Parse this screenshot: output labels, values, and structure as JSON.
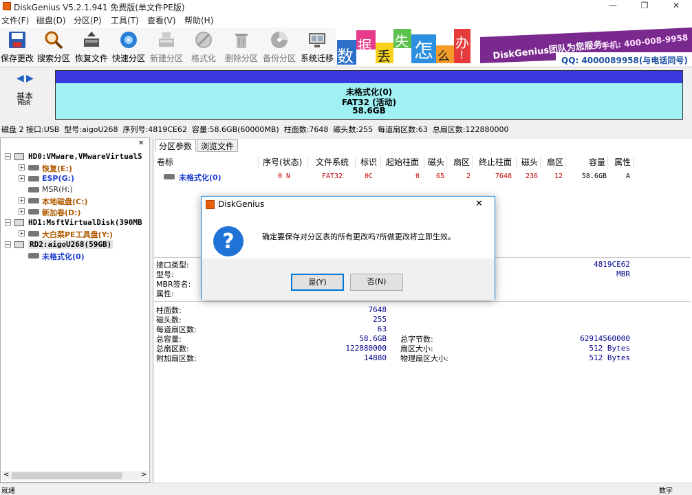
{
  "window": {
    "title": "DiskGenius V5.2.1.941 免费版(单文件PE版)",
    "minimize": "—",
    "maximize": "❐",
    "close": "✕"
  },
  "menu": [
    "文件(F)",
    "磁盘(D)",
    "分区(P)",
    "工具(T)",
    "查看(V)",
    "帮助(H)"
  ],
  "toolbar": [
    "保存更改",
    "搜索分区",
    "恢复文件",
    "快速分区",
    "新建分区",
    "格式化",
    "删除分区",
    "备份分区",
    "系统迁移"
  ],
  "banner": {
    "chars": [
      "数",
      "据",
      "丢",
      "失",
      "怎",
      "么",
      "办",
      "!"
    ],
    "team": "DiskGenius团队为您服务:",
    "phone": "手机: 400-008-9958",
    "qq": "QQ: 4000089958(与电话同号)"
  },
  "diskmap": {
    "type": "基本",
    "scheme": "MBR",
    "part_name": "未格式化(0)",
    "part_fs": "FAT32 (活动)",
    "part_size": "58.6GB"
  },
  "diskinfo": "磁盘 2 接口:USB  型号:aigoU268  序列号:4819CE62  容量:58.6GB(60000MB)  柱面数:7648  磁头数:255  每道扇区数:63  总扇区数:122880000",
  "tree": {
    "hd0": "HD0:VMware,VMwareVirtualS",
    "hd0_parts": [
      "恢复(E:)",
      "ESP(G:)",
      "MSR(H:)",
      "本地磁盘(C:)",
      "新加卷(D:)"
    ],
    "hd1": "HD1:MsftVirtualDisk(390MB",
    "hd1_parts": [
      "大白菜PE工具盘(Y:)"
    ],
    "rd2": "RD2:aigoU268(59GB)",
    "rd2_parts": [
      "未格式化(0)"
    ]
  },
  "tabs": [
    "分区参数",
    "浏览文件"
  ],
  "columns": [
    "卷标",
    "序号(状态)",
    "文件系统",
    "标识",
    "起始柱面",
    "磁头",
    "扇区",
    "终止柱面",
    "磁头",
    "扇区",
    "容量",
    "属性"
  ],
  "row": [
    "未格式化(0)",
    "0 N",
    "FAT32",
    "0C",
    "0",
    "65",
    "2",
    "7648",
    "236",
    "12",
    "58.6GB",
    "A"
  ],
  "details": {
    "interface_label": "接口类型:",
    "model_label": "型号:",
    "mbr_label": "MBR签名:",
    "attr_label": "属性:",
    "serial": "4819CE62",
    "scheme": "MBR",
    "cyl_label": "柱面数:",
    "cyl": "7648",
    "heads_label": "磁头数:",
    "heads": "255",
    "spt_label": "每道扇区数:",
    "spt": "63",
    "cap_label": "总容量:",
    "cap": "58.6GB",
    "sectors_label": "总扇区数:",
    "sectors": "122880000",
    "extra_label": "附加扇区数:",
    "extra": "14880",
    "bytes_label": "总字节数:",
    "bytes": "62914560000",
    "secsize_label": "扇区大小:",
    "secsize": "512 Bytes",
    "physsec_label": "物理扇区大小:",
    "physsec": "512 Bytes"
  },
  "dialog": {
    "title": "DiskGenius",
    "message": "确定要保存对分区表的所有更改吗?所做更改将立即生效。",
    "yes": "是(Y)",
    "no": "否(N)",
    "close": "✕"
  },
  "status": {
    "left": "就绪",
    "right": "数字"
  },
  "colors": {
    "partition_top": "#3a3ae0",
    "partition_fill": "#9ff1f4",
    "accent": "#1883d7"
  }
}
